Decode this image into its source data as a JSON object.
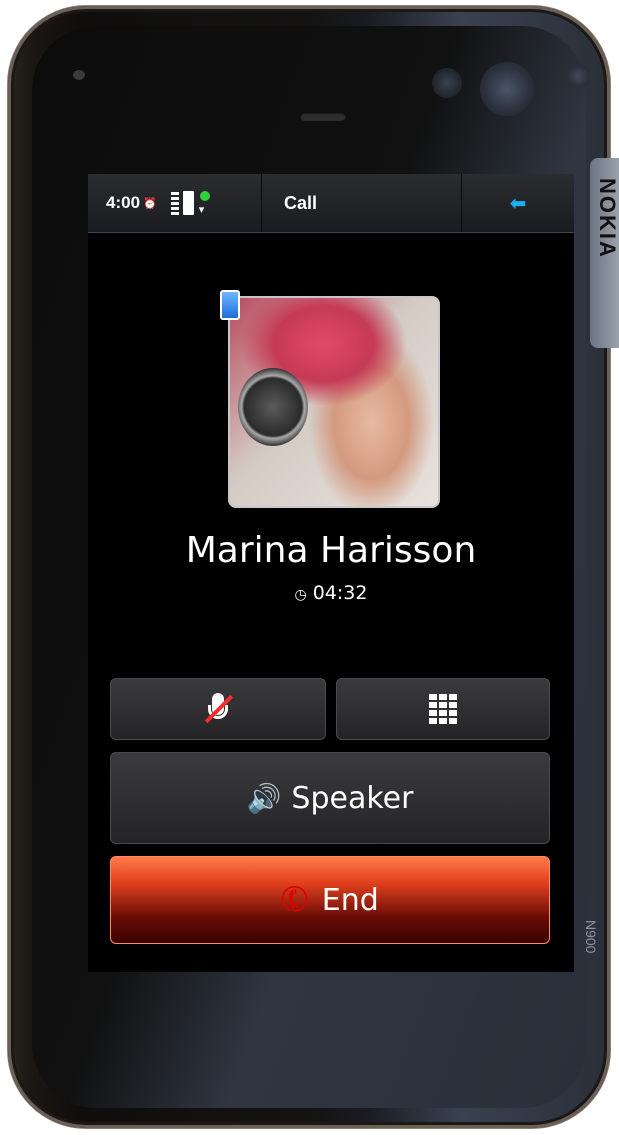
{
  "device": {
    "brand": "NOKIA",
    "model": "N900"
  },
  "status_bar": {
    "time": "4:00",
    "alarm_icon": "alarm-icon",
    "title": "Call",
    "back_icon": "back-arrow-icon"
  },
  "call": {
    "caller_name": "Marina Harisson",
    "duration": "04:32"
  },
  "buttons": {
    "mute_icon": "mute-microphone-icon",
    "keypad_icon": "dialpad-icon",
    "speaker_label": "Speaker",
    "end_label": "End"
  },
  "colors": {
    "accent_back": "#1ab0f0",
    "end_button": "#e1401d",
    "mute_slash": "#ff2a2a",
    "network_dot": "#2fd13a"
  }
}
